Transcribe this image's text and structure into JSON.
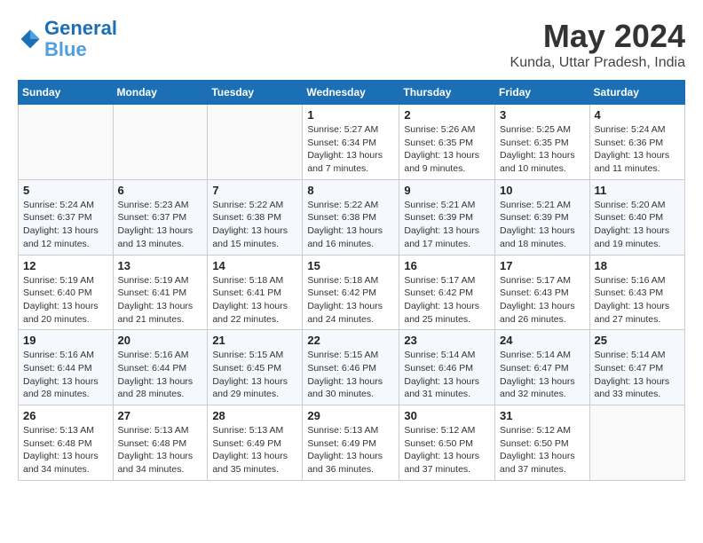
{
  "logo": {
    "line1": "General",
    "line2": "Blue"
  },
  "title": "May 2024",
  "location": "Kunda, Uttar Pradesh, India",
  "days_of_week": [
    "Sunday",
    "Monday",
    "Tuesday",
    "Wednesday",
    "Thursday",
    "Friday",
    "Saturday"
  ],
  "weeks": [
    [
      {
        "day": "",
        "info": ""
      },
      {
        "day": "",
        "info": ""
      },
      {
        "day": "",
        "info": ""
      },
      {
        "day": "1",
        "sunrise": "5:27 AM",
        "sunset": "6:34 PM",
        "daylight": "13 hours and 7 minutes."
      },
      {
        "day": "2",
        "sunrise": "5:26 AM",
        "sunset": "6:35 PM",
        "daylight": "13 hours and 9 minutes."
      },
      {
        "day": "3",
        "sunrise": "5:25 AM",
        "sunset": "6:35 PM",
        "daylight": "13 hours and 10 minutes."
      },
      {
        "day": "4",
        "sunrise": "5:24 AM",
        "sunset": "6:36 PM",
        "daylight": "13 hours and 11 minutes."
      }
    ],
    [
      {
        "day": "5",
        "sunrise": "5:24 AM",
        "sunset": "6:37 PM",
        "daylight": "13 hours and 12 minutes."
      },
      {
        "day": "6",
        "sunrise": "5:23 AM",
        "sunset": "6:37 PM",
        "daylight": "13 hours and 13 minutes."
      },
      {
        "day": "7",
        "sunrise": "5:22 AM",
        "sunset": "6:38 PM",
        "daylight": "13 hours and 15 minutes."
      },
      {
        "day": "8",
        "sunrise": "5:22 AM",
        "sunset": "6:38 PM",
        "daylight": "13 hours and 16 minutes."
      },
      {
        "day": "9",
        "sunrise": "5:21 AM",
        "sunset": "6:39 PM",
        "daylight": "13 hours and 17 minutes."
      },
      {
        "day": "10",
        "sunrise": "5:21 AM",
        "sunset": "6:39 PM",
        "daylight": "13 hours and 18 minutes."
      },
      {
        "day": "11",
        "sunrise": "5:20 AM",
        "sunset": "6:40 PM",
        "daylight": "13 hours and 19 minutes."
      }
    ],
    [
      {
        "day": "12",
        "sunrise": "5:19 AM",
        "sunset": "6:40 PM",
        "daylight": "13 hours and 20 minutes."
      },
      {
        "day": "13",
        "sunrise": "5:19 AM",
        "sunset": "6:41 PM",
        "daylight": "13 hours and 21 minutes."
      },
      {
        "day": "14",
        "sunrise": "5:18 AM",
        "sunset": "6:41 PM",
        "daylight": "13 hours and 22 minutes."
      },
      {
        "day": "15",
        "sunrise": "5:18 AM",
        "sunset": "6:42 PM",
        "daylight": "13 hours and 24 minutes."
      },
      {
        "day": "16",
        "sunrise": "5:17 AM",
        "sunset": "6:42 PM",
        "daylight": "13 hours and 25 minutes."
      },
      {
        "day": "17",
        "sunrise": "5:17 AM",
        "sunset": "6:43 PM",
        "daylight": "13 hours and 26 minutes."
      },
      {
        "day": "18",
        "sunrise": "5:16 AM",
        "sunset": "6:43 PM",
        "daylight": "13 hours and 27 minutes."
      }
    ],
    [
      {
        "day": "19",
        "sunrise": "5:16 AM",
        "sunset": "6:44 PM",
        "daylight": "13 hours and 28 minutes."
      },
      {
        "day": "20",
        "sunrise": "5:16 AM",
        "sunset": "6:44 PM",
        "daylight": "13 hours and 28 minutes."
      },
      {
        "day": "21",
        "sunrise": "5:15 AM",
        "sunset": "6:45 PM",
        "daylight": "13 hours and 29 minutes."
      },
      {
        "day": "22",
        "sunrise": "5:15 AM",
        "sunset": "6:46 PM",
        "daylight": "13 hours and 30 minutes."
      },
      {
        "day": "23",
        "sunrise": "5:14 AM",
        "sunset": "6:46 PM",
        "daylight": "13 hours and 31 minutes."
      },
      {
        "day": "24",
        "sunrise": "5:14 AM",
        "sunset": "6:47 PM",
        "daylight": "13 hours and 32 minutes."
      },
      {
        "day": "25",
        "sunrise": "5:14 AM",
        "sunset": "6:47 PM",
        "daylight": "13 hours and 33 minutes."
      }
    ],
    [
      {
        "day": "26",
        "sunrise": "5:13 AM",
        "sunset": "6:48 PM",
        "daylight": "13 hours and 34 minutes."
      },
      {
        "day": "27",
        "sunrise": "5:13 AM",
        "sunset": "6:48 PM",
        "daylight": "13 hours and 34 minutes."
      },
      {
        "day": "28",
        "sunrise": "5:13 AM",
        "sunset": "6:49 PM",
        "daylight": "13 hours and 35 minutes."
      },
      {
        "day": "29",
        "sunrise": "5:13 AM",
        "sunset": "6:49 PM",
        "daylight": "13 hours and 36 minutes."
      },
      {
        "day": "30",
        "sunrise": "5:12 AM",
        "sunset": "6:50 PM",
        "daylight": "13 hours and 37 minutes."
      },
      {
        "day": "31",
        "sunrise": "5:12 AM",
        "sunset": "6:50 PM",
        "daylight": "13 hours and 37 minutes."
      },
      {
        "day": "",
        "info": ""
      }
    ]
  ],
  "labels": {
    "sunrise_prefix": "Sunrise: ",
    "sunset_prefix": "Sunset: ",
    "daylight_prefix": "Daylight: "
  }
}
